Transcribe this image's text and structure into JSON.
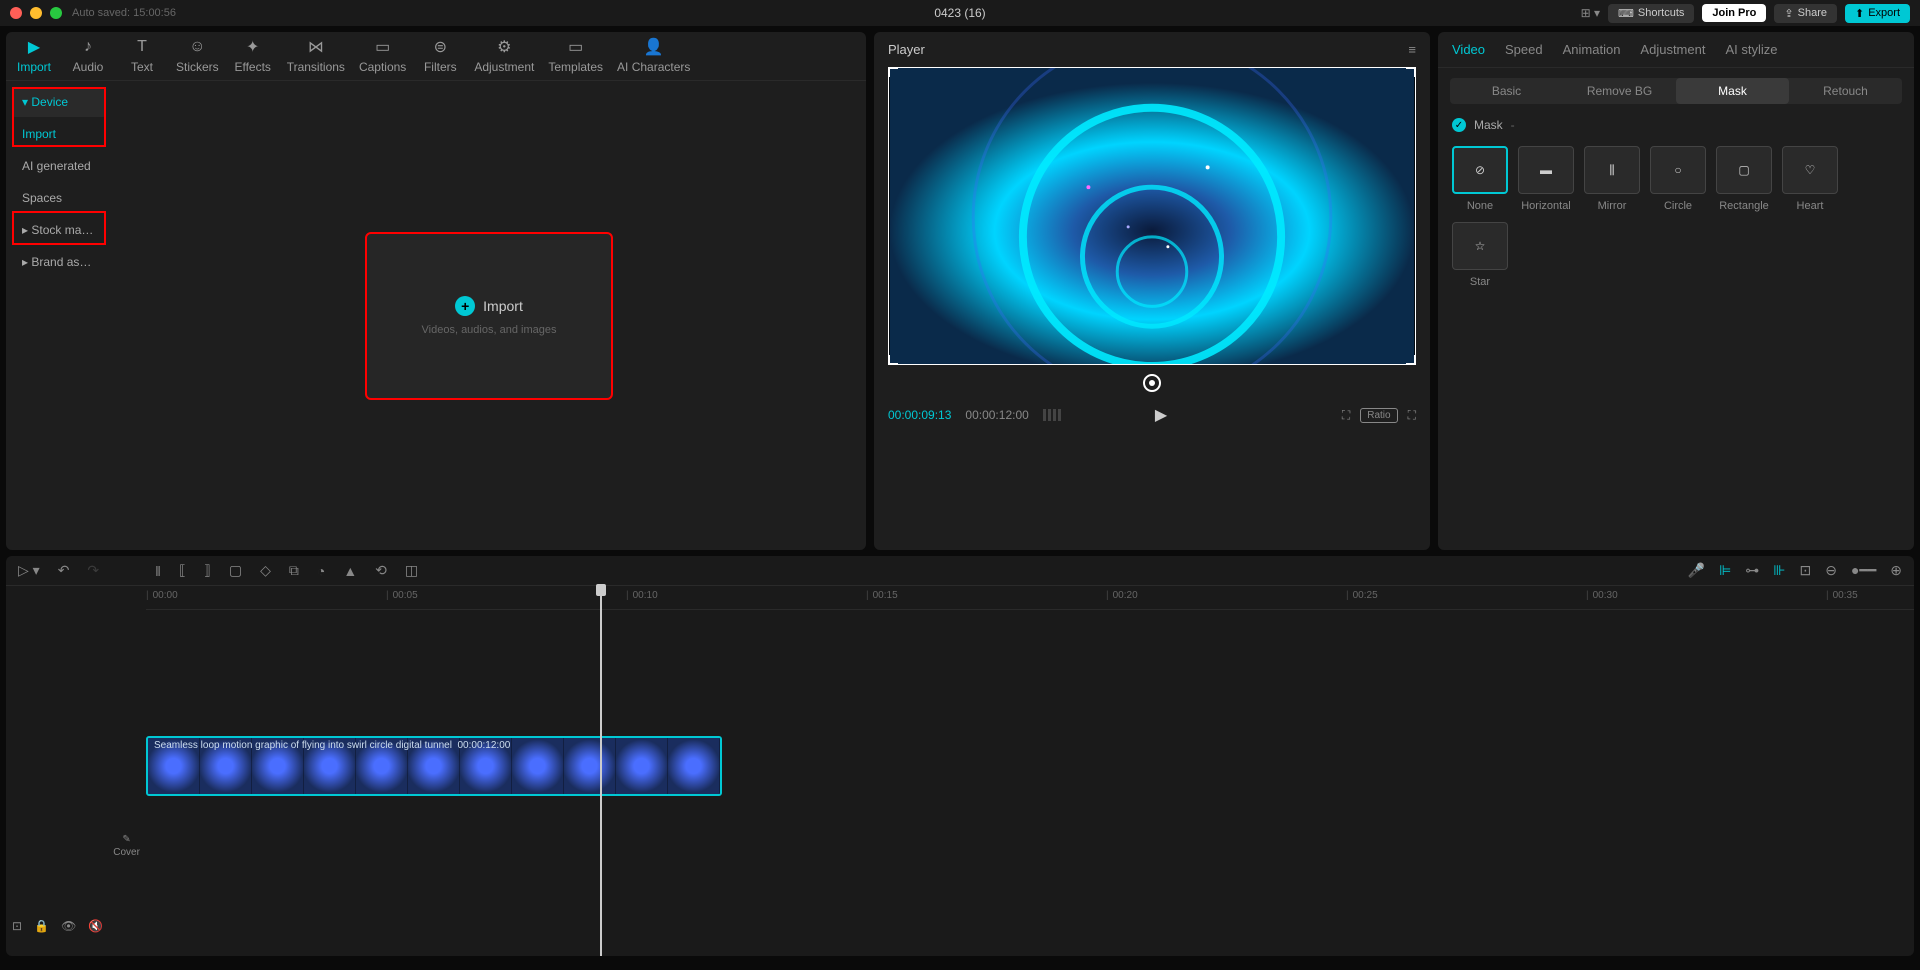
{
  "titlebar": {
    "autosave": "Auto saved: 15:00:56",
    "title": "0423 (16)",
    "shortcuts": "Shortcuts",
    "joinPro": "Join Pro",
    "share": "Share",
    "export": "Export"
  },
  "toolbar": [
    {
      "label": "Import",
      "active": true
    },
    {
      "label": "Audio"
    },
    {
      "label": "Text"
    },
    {
      "label": "Stickers"
    },
    {
      "label": "Effects"
    },
    {
      "label": "Transitions"
    },
    {
      "label": "Captions"
    },
    {
      "label": "Filters"
    },
    {
      "label": "Adjustment"
    },
    {
      "label": "Templates"
    },
    {
      "label": "AI Characters"
    }
  ],
  "sidebar": [
    {
      "label": "Device",
      "sel": true,
      "act": true,
      "arrow": "▾"
    },
    {
      "label": "Import",
      "act": true
    },
    {
      "label": "AI generated"
    },
    {
      "label": "Spaces"
    },
    {
      "label": "Stock mate...",
      "arrow": "▸"
    },
    {
      "label": "Brand assets",
      "arrow": "▸"
    }
  ],
  "importCard": {
    "title": "Import",
    "sub": "Videos, audios, and images"
  },
  "player": {
    "title": "Player",
    "cur": "00:00:09:13",
    "dur": "00:00:12:00",
    "ratio": "Ratio"
  },
  "propTabs": [
    {
      "l": "Video",
      "a": true
    },
    {
      "l": "Speed"
    },
    {
      "l": "Animation"
    },
    {
      "l": "Adjustment"
    },
    {
      "l": "AI stylize"
    }
  ],
  "subTabs": [
    {
      "l": "Basic"
    },
    {
      "l": "Remove BG"
    },
    {
      "l": "Mask",
      "a": true
    },
    {
      "l": "Retouch"
    }
  ],
  "maskHead": "Mask",
  "masks": [
    {
      "l": "None",
      "sel": true,
      "icon": "none"
    },
    {
      "l": "Horizontal",
      "icon": "horiz"
    },
    {
      "l": "Mirror",
      "icon": "mirror"
    },
    {
      "l": "Circle",
      "icon": "circle"
    },
    {
      "l": "Rectangle",
      "icon": "rect"
    },
    {
      "l": "Heart",
      "icon": "heart"
    },
    {
      "l": "Star",
      "icon": "star"
    }
  ],
  "ruler": [
    "00:00",
    "00:05",
    "00:10",
    "00:15",
    "00:20",
    "00:25",
    "00:30",
    "00:35"
  ],
  "clip": {
    "label": "Seamless loop motion graphic of flying into swirl circle digital tunnel",
    "dur": "00:00:12:00"
  },
  "cover": "Cover"
}
